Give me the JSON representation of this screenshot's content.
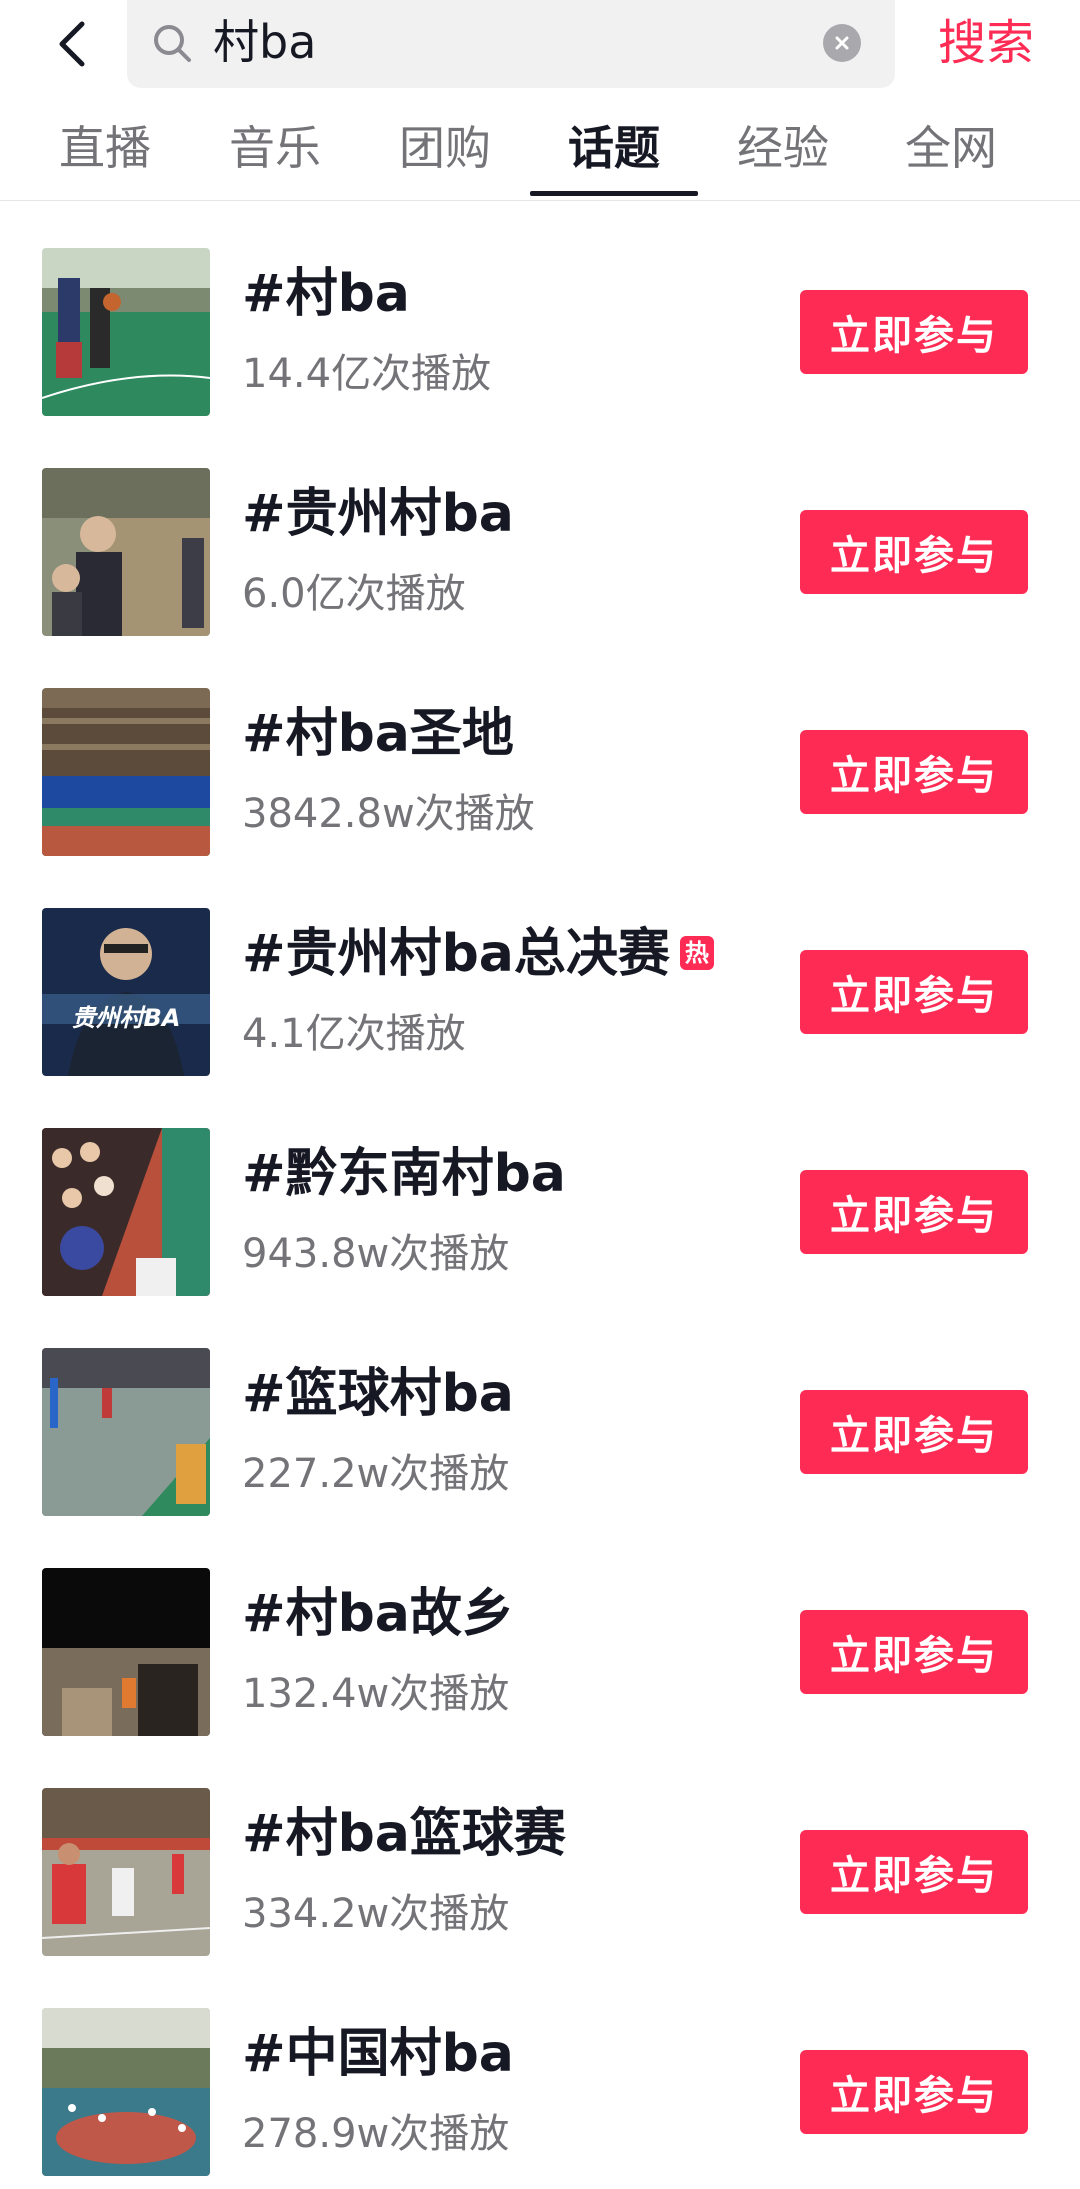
{
  "search": {
    "query": "村ba",
    "submit_label": "搜索"
  },
  "tabs": [
    {
      "label": "直播",
      "active": false
    },
    {
      "label": "音乐",
      "active": false
    },
    {
      "label": "团购",
      "active": false
    },
    {
      "label": "话题",
      "active": true
    },
    {
      "label": "经验",
      "active": false
    },
    {
      "label": "全网",
      "active": false
    }
  ],
  "topics": [
    {
      "title": "#村ba",
      "views": "14.4亿次播放",
      "button": "立即参与",
      "hot": false
    },
    {
      "title": "#贵州村ba",
      "views": "6.0亿次播放",
      "button": "立即参与",
      "hot": false
    },
    {
      "title": "#村ba圣地",
      "views": "3842.8w次播放",
      "button": "立即参与",
      "hot": false
    },
    {
      "title": "#贵州村ba总决赛",
      "views": "4.1亿次播放",
      "button": "立即参与",
      "hot": true,
      "hot_label": "热",
      "thumb_text": "贵州村BA"
    },
    {
      "title": "#黔东南村ba",
      "views": "943.8w次播放",
      "button": "立即参与",
      "hot": false
    },
    {
      "title": "#篮球村ba",
      "views": "227.2w次播放",
      "button": "立即参与",
      "hot": false
    },
    {
      "title": "#村ba故乡",
      "views": "132.4w次播放",
      "button": "立即参与",
      "hot": false
    },
    {
      "title": "#村ba篮球赛",
      "views": "334.2w次播放",
      "button": "立即参与",
      "hot": false
    },
    {
      "title": "#中国村ba",
      "views": "278.9w次播放",
      "button": "立即参与",
      "hot": false
    }
  ],
  "colors": {
    "accent": "#fe2c55",
    "text_primary": "#161823",
    "text_secondary": "#737378",
    "search_bg": "#f1f1f2"
  },
  "icons": {
    "back": "chevron-left-icon",
    "search": "search-icon",
    "clear": "clear-icon"
  }
}
